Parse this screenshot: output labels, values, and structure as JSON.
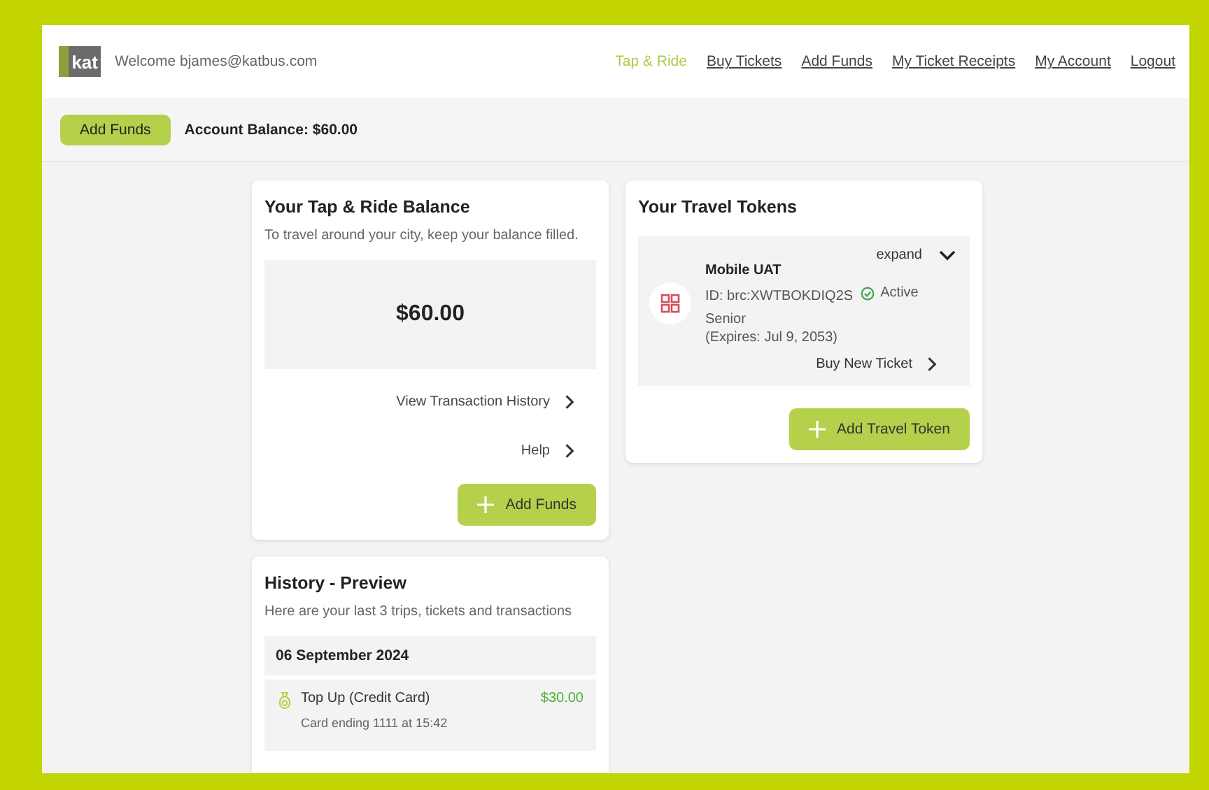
{
  "header": {
    "logo_text": "kat",
    "welcome": "Welcome bjames@katbus.com",
    "nav": [
      {
        "label": "Tap & Ride",
        "selected": true
      },
      {
        "label": "Buy Tickets",
        "selected": false
      },
      {
        "label": "Add Funds",
        "selected": false
      },
      {
        "label": "My Ticket Receipts",
        "selected": false
      },
      {
        "label": "My Account",
        "selected": false
      },
      {
        "label": "Logout",
        "selected": false
      }
    ]
  },
  "account_bar": {
    "button": "Add Funds",
    "balance": "Account Balance: $60.00"
  },
  "balance_card": {
    "title": "Your Tap & Ride Balance",
    "subtitle": "To travel around your city, keep your balance filled.",
    "amount": "$60.00",
    "links": [
      "View Transaction History",
      "Help"
    ],
    "button": "Add Funds"
  },
  "tokens_card": {
    "title": "Your Travel Tokens",
    "expand": "expand",
    "token": {
      "name": "Mobile UAT",
      "id": "ID: brc:XWTBOKDIQ2S",
      "status": "Active",
      "type": "Senior",
      "expires": "(Expires: Jul 9, 2053)"
    },
    "link": "Buy New Ticket",
    "button": "Add Travel Token"
  },
  "history_card": {
    "title": "History - Preview",
    "subtitle": "Here are your last 3 trips, tickets and transactions",
    "date": "06 September 2024",
    "items": [
      {
        "title": "Top Up (Credit Card)",
        "detail": "Card ending 1111 at 15:42",
        "amount": "$30.00"
      }
    ]
  }
}
